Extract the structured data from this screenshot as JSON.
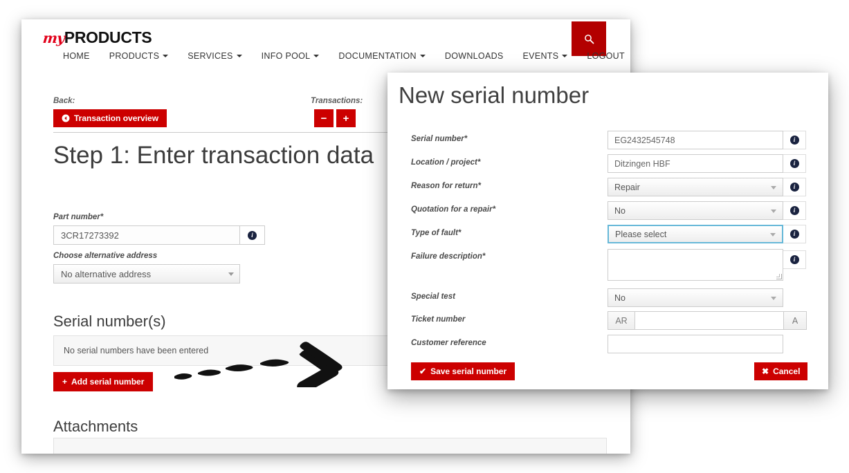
{
  "site": {
    "brand_prefix": "my",
    "brand_name": "PRODUCTS",
    "search_icon": "search-icon"
  },
  "nav": {
    "items": [
      {
        "label": "HOME",
        "has_caret": false
      },
      {
        "label": "PRODUCTS",
        "has_caret": true
      },
      {
        "label": "SERVICES",
        "has_caret": true
      },
      {
        "label": "INFO POOL",
        "has_caret": true
      },
      {
        "label": "DOCUMENTATION",
        "has_caret": true
      },
      {
        "label": "DOWNLOADS",
        "has_caret": false
      },
      {
        "label": "EVENTS",
        "has_caret": true
      },
      {
        "label": "LOGOUT",
        "has_caret": false
      }
    ]
  },
  "toolbar": {
    "back_label": "Back:",
    "back_button": "Transaction overview",
    "back_icon": "arrow-left-circle-icon",
    "transactions_label": "Transactions:",
    "minus_label": "−",
    "plus_label": "+"
  },
  "page": {
    "title": "Step 1: Enter transaction data",
    "part_number_label": "Part number*",
    "part_number_value": "3CR17273392",
    "alt_address_label": "Choose alternative address",
    "alt_address_value": "No alternative address",
    "serial_section_title": "Serial number(s)",
    "serial_empty_text": "No serial numbers have been entered",
    "add_serial_button": "Add serial number",
    "attachments_section_title": "Attachments"
  },
  "modal": {
    "title": "New serial number",
    "fields": [
      {
        "label": "Serial number*",
        "type": "text",
        "value": "EG2432545748",
        "info": true
      },
      {
        "label": "Location / project*",
        "type": "text",
        "value": "Ditzingen HBF",
        "info": true
      },
      {
        "label": "Reason for return*",
        "type": "select",
        "value": "Repair",
        "info": true
      },
      {
        "label": "Quotation for a repair*",
        "type": "select",
        "value": "No",
        "info": true
      },
      {
        "label": "Type of fault*",
        "type": "select",
        "value": "Please select",
        "info": true,
        "focused": true
      },
      {
        "label": "Failure description*",
        "type": "textarea",
        "value": "",
        "info": true
      },
      {
        "label": "Special test",
        "type": "select",
        "value": "No",
        "info": false
      },
      {
        "label": "Ticket number",
        "type": "group",
        "value": "",
        "prefix": "AR",
        "suffix": "A",
        "info": false
      },
      {
        "label": "Customer reference",
        "type": "text",
        "value": "",
        "info": false
      }
    ],
    "save_button": "Save serial number",
    "save_icon": "check-icon",
    "cancel_button": "Cancel",
    "cancel_icon": "close-icon"
  },
  "annotation": {
    "type": "hand-drawn-dashed-arrow",
    "direction": "right"
  },
  "colors": {
    "brand_red": "#e2001a",
    "button_red": "#cc0000",
    "search_red": "#b30000",
    "focus_blue": "#66b8d8",
    "info_navy": "#1a2340"
  }
}
